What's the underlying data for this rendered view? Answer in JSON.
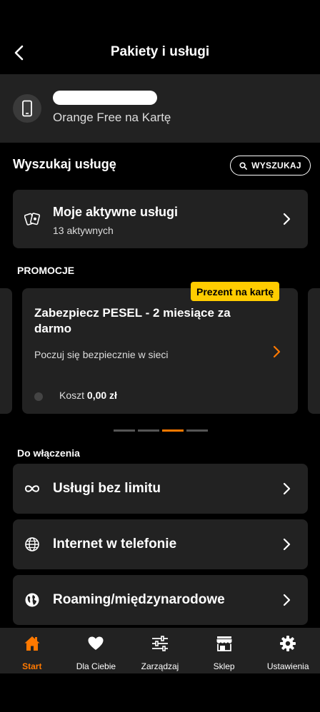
{
  "header": {
    "title": "Pakiety i usługi",
    "back_icon": "chevron-left-icon"
  },
  "account": {
    "icon": "phone-icon",
    "plan": "Orange Free na Kartę"
  },
  "search": {
    "title": "Wyszukaj usługę",
    "button_label": "WYSZUKAJ",
    "button_icon": "search-icon"
  },
  "active_services": {
    "icon": "cards-icon",
    "title": "Moje aktywne usługi",
    "subtitle": "13 aktywnych"
  },
  "promotions": {
    "section_label": "PROMOCJE",
    "card": {
      "badge": "Prezent na kartę",
      "title": "Zabezpiecz PESEL - 2 miesiące za darmo",
      "description": "Poczuj się bezpiecznie w sieci",
      "cost_label": "Koszt",
      "cost_value": "0,00 zł"
    },
    "pager": {
      "count": 4,
      "active_index": 2
    }
  },
  "to_enable": {
    "section_label": "Do włączenia",
    "items": [
      {
        "label": "Usługi bez limitu",
        "icon": "infinity-icon"
      },
      {
        "label": "Internet w telefonie",
        "icon": "globe-icon"
      },
      {
        "label": "Roaming/międzynarodowe",
        "icon": "world-icon"
      }
    ]
  },
  "tabbar": {
    "tabs": [
      {
        "label": "Start",
        "icon": "home-icon",
        "active": true
      },
      {
        "label": "Dla Ciebie",
        "icon": "heart-icon",
        "active": false
      },
      {
        "label": "Zarządzaj",
        "icon": "sliders-icon",
        "active": false
      },
      {
        "label": "Sklep",
        "icon": "shop-icon",
        "active": false
      },
      {
        "label": "Ustawienia",
        "icon": "gear-icon",
        "active": false
      }
    ]
  },
  "colors": {
    "accent": "#ff7900",
    "badge": "#ffcc00",
    "card": "#222222",
    "background": "#000000"
  }
}
